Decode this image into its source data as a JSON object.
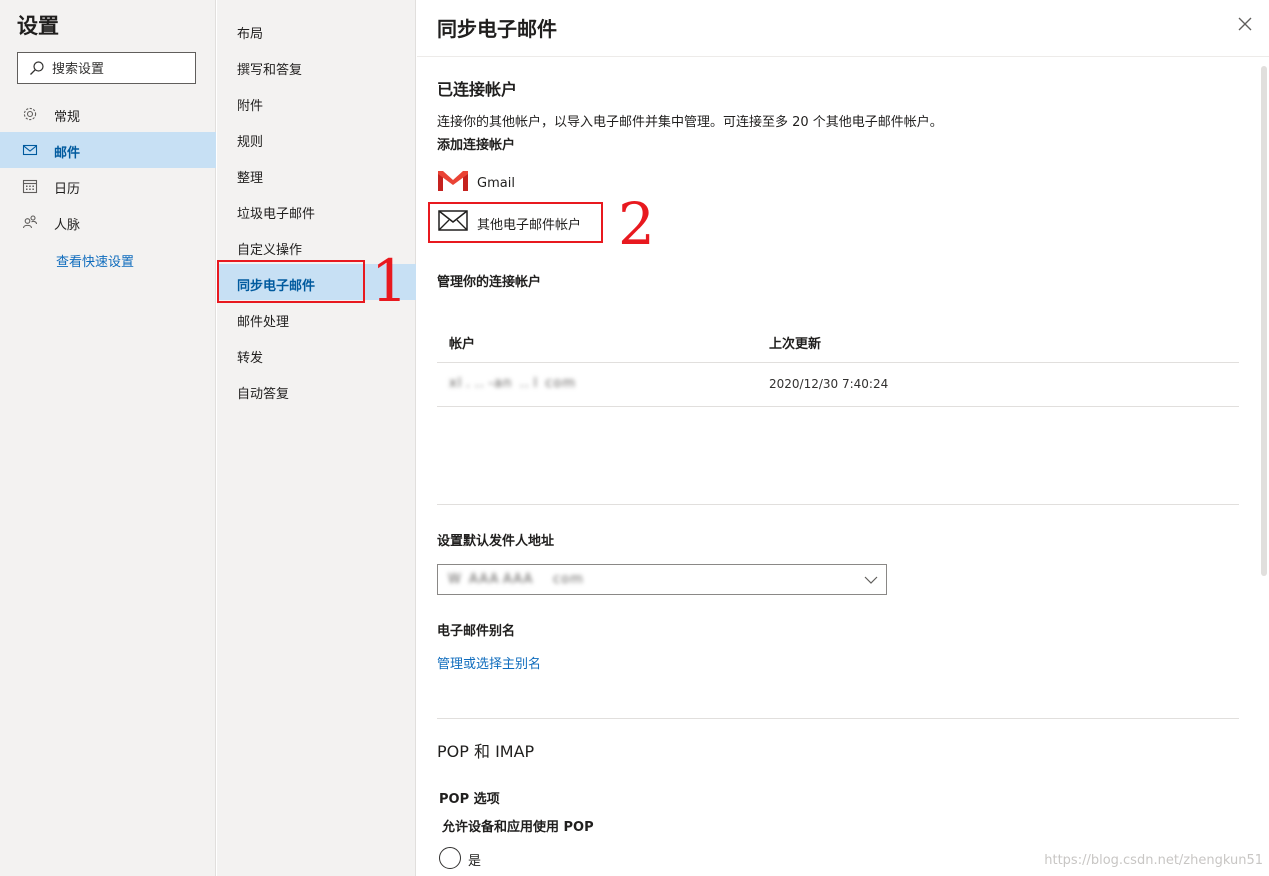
{
  "nav": {
    "title": "设置",
    "search_placeholder": "搜索设置",
    "items": [
      {
        "label": "常规",
        "icon": "gear-icon"
      },
      {
        "label": "邮件",
        "icon": "mail-icon"
      },
      {
        "label": "日历",
        "icon": "calendar-icon"
      },
      {
        "label": "人脉",
        "icon": "people-icon"
      }
    ],
    "quick_settings_link": "查看快速设置"
  },
  "mail_menu": {
    "items": [
      "布局",
      "撰写和答复",
      "附件",
      "规则",
      "整理",
      "垃圾电子邮件",
      "自定义操作",
      "同步电子邮件",
      "邮件处理",
      "转发",
      "自动答复"
    ],
    "active": "同步电子邮件"
  },
  "panel": {
    "title": "同步电子邮件",
    "connected_heading": "已连接帐户",
    "connected_desc": "连接你的其他帐户，以导入电子邮件并集中管理。可连接至多 20 个其他电子邮件帐户。",
    "add_heading": "添加连接帐户",
    "gmail_label": "Gmail",
    "other_label": "其他电子邮件帐户",
    "manage_heading": "管理你的连接帐户",
    "table_headers": {
      "account": "帐户",
      "updated": "上次更新"
    },
    "table_rows": [
      {
        "account": "xl . .. -an  .. l  com",
        "updated": "2020/12/30 7:40:24"
      }
    ],
    "default_from_heading": "设置默认发件人地址",
    "default_from_value": "W  AAA AAA     com",
    "alias_heading": "电子邮件别名",
    "alias_link": "管理或选择主别名",
    "pop_imap_heading": "POP 和 IMAP",
    "pop_options": "POP 选项",
    "pop_allow": "允许设备和应用使用 POP",
    "radio_yes": "是"
  },
  "annotations": {
    "mark1": "1",
    "mark2": "2"
  },
  "watermark": "https://blog.csdn.net/zhengkun51",
  "colors": {
    "accent": "#0f6cbd",
    "active_bg": "#c7e0f4",
    "sidebar_bg": "#f3f2f1",
    "annotation_red": "#e8191f"
  }
}
